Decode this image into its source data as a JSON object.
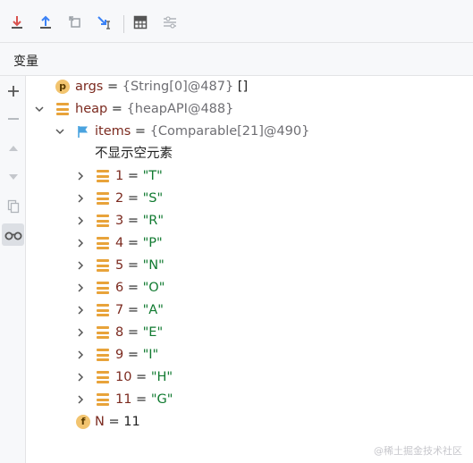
{
  "toolbar": {
    "buttons": [
      {
        "icon": "step-into-icon",
        "color": "#d9534f"
      },
      {
        "icon": "step-out-icon",
        "color": "#3b82f6"
      },
      {
        "icon": "drop-frame-icon",
        "color": "#9aa0a6"
      },
      {
        "icon": "run-to-cursor-icon",
        "color": "#3b82f6"
      },
      {
        "icon": "evaluate-expression-icon",
        "color": "#555555"
      },
      {
        "icon": "trace-current-stream-icon",
        "color": "#b0b4ba"
      }
    ]
  },
  "panel": {
    "tab_label": "变量"
  },
  "sidebar": {
    "items": [
      "add-icon",
      "remove-icon",
      "move-up-icon",
      "move-down-icon",
      "copy-icon",
      "watches-glasses-icon"
    ]
  },
  "tree": {
    "args": {
      "badge": "p",
      "name": "args",
      "eq": " = ",
      "ref": "{String[0]@487}",
      "tail": " []"
    },
    "heap": {
      "name": "heap",
      "eq": " = ",
      "ref": "{heapAPI@488}"
    },
    "items": {
      "name": "items",
      "eq": " = ",
      "ref": "{Comparable[21]@490}"
    },
    "hide_empty_label": "不显示空元素",
    "entries": [
      {
        "index": "1",
        "value": "\"T\""
      },
      {
        "index": "2",
        "value": "\"S\""
      },
      {
        "index": "3",
        "value": "\"R\""
      },
      {
        "index": "4",
        "value": "\"P\""
      },
      {
        "index": "5",
        "value": "\"N\""
      },
      {
        "index": "6",
        "value": "\"O\""
      },
      {
        "index": "7",
        "value": "\"A\""
      },
      {
        "index": "8",
        "value": "\"E\""
      },
      {
        "index": "9",
        "value": "\"I\""
      },
      {
        "index": "10",
        "value": "\"H\""
      },
      {
        "index": "11",
        "value": "\"G\""
      }
    ],
    "n_field": {
      "badge": "f",
      "name": "N",
      "eq": " = ",
      "value": "11"
    }
  },
  "watermark": "@稀土掘金技术社区",
  "colors": {
    "variable_name": "#7b2a1f",
    "string_value": "#107a30",
    "reference": "#6e6e73",
    "badge": "#f2c46f",
    "stack_icon": "#e8a33a"
  }
}
